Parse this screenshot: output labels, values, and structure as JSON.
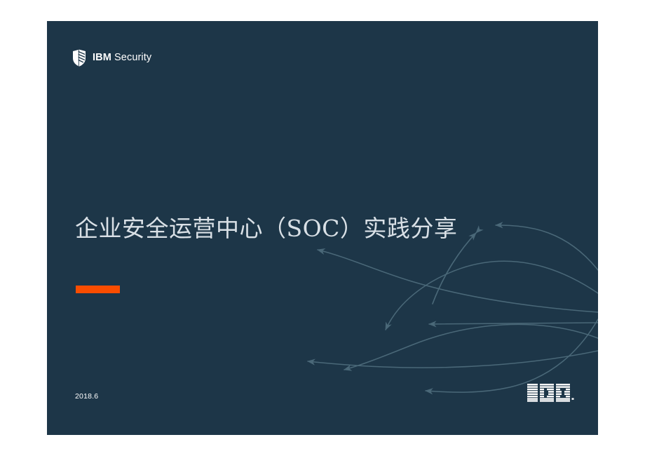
{
  "slide": {
    "background_color": "#1d3648",
    "page_background_color": "#ffffff",
    "brand": {
      "icon": "ibm-security-shield-icon",
      "name_bold": "IBM",
      "name_regular": "Security",
      "full_text": "IBM Security",
      "color": "#ffffff"
    },
    "title": "企业安全运营中心（SOC）实践分享",
    "title_color": "#d9e0e6",
    "accent_bar": {
      "color": "#fa4d00",
      "label": "orange-accent-bar"
    },
    "date": "2018.6",
    "date_color": "#ffffff",
    "footer_logo": {
      "icon": "ibm-logo",
      "text": "IBM",
      "color": "#ffffff"
    },
    "decoration": {
      "name": "flowing-arrow-curves",
      "stroke_color": "#4a6878",
      "stroke_width": 1.5,
      "arrow_count": 7
    }
  }
}
